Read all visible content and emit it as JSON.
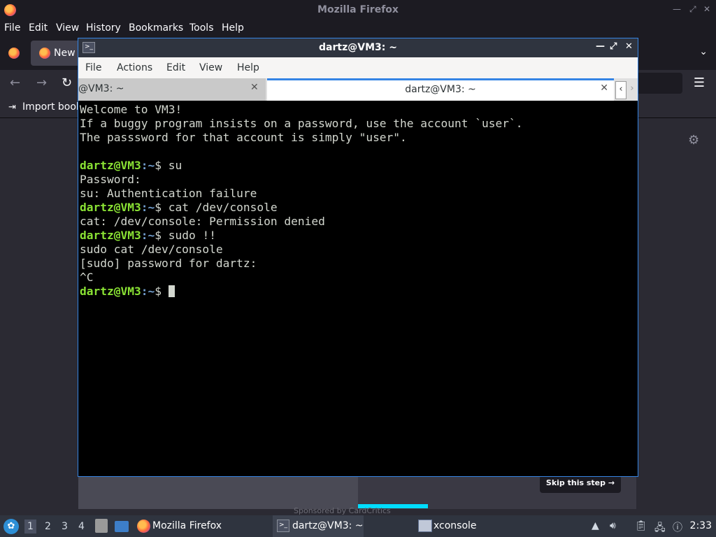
{
  "firefox": {
    "title": "Mozilla Firefox",
    "menu": [
      "File",
      "Edit",
      "View",
      "History",
      "Bookmarks",
      "Tools",
      "Help"
    ],
    "tab_label": "New",
    "import_bookmarks": "Import book",
    "sponsor_text": "Sponsored by CardCritics",
    "skip_label": "Skip this step →"
  },
  "terminal": {
    "title": "dartz@VM3: ~",
    "menu": [
      "File",
      "Actions",
      "Edit",
      "View",
      "Help"
    ],
    "tabs": [
      {
        "label": "@VM3: ~"
      },
      {
        "label": "dartz@VM3: ~"
      }
    ],
    "prompt_user": "dartz@VM3",
    "prompt_path": ":~",
    "prompt_symbol": "$ ",
    "lines": [
      {
        "type": "text",
        "text": "Welcome to VM3!"
      },
      {
        "type": "text",
        "text": "If a buggy program insists on a password, use the account `user`."
      },
      {
        "type": "text",
        "text": "The passsword for that account is simply \"user\"."
      },
      {
        "type": "text",
        "text": ""
      },
      {
        "type": "cmd",
        "text": "su"
      },
      {
        "type": "text",
        "text": "Password:"
      },
      {
        "type": "text",
        "text": "su: Authentication failure"
      },
      {
        "type": "cmd",
        "text": "cat /dev/console"
      },
      {
        "type": "text",
        "text": "cat: /dev/console: Permission denied"
      },
      {
        "type": "cmd",
        "text": "sudo !!"
      },
      {
        "type": "text",
        "text": "sudo cat /dev/console"
      },
      {
        "type": "text",
        "text": "[sudo] password for dartz:"
      },
      {
        "type": "text",
        "text": "^C"
      },
      {
        "type": "cmd",
        "text": ""
      }
    ]
  },
  "taskbar": {
    "workspaces": [
      "1",
      "2",
      "3",
      "4"
    ],
    "windows": [
      {
        "label": "Mozilla Firefox"
      },
      {
        "label": "dartz@VM3: ~"
      },
      {
        "label": "xconsole"
      }
    ],
    "clock": "2:33"
  }
}
